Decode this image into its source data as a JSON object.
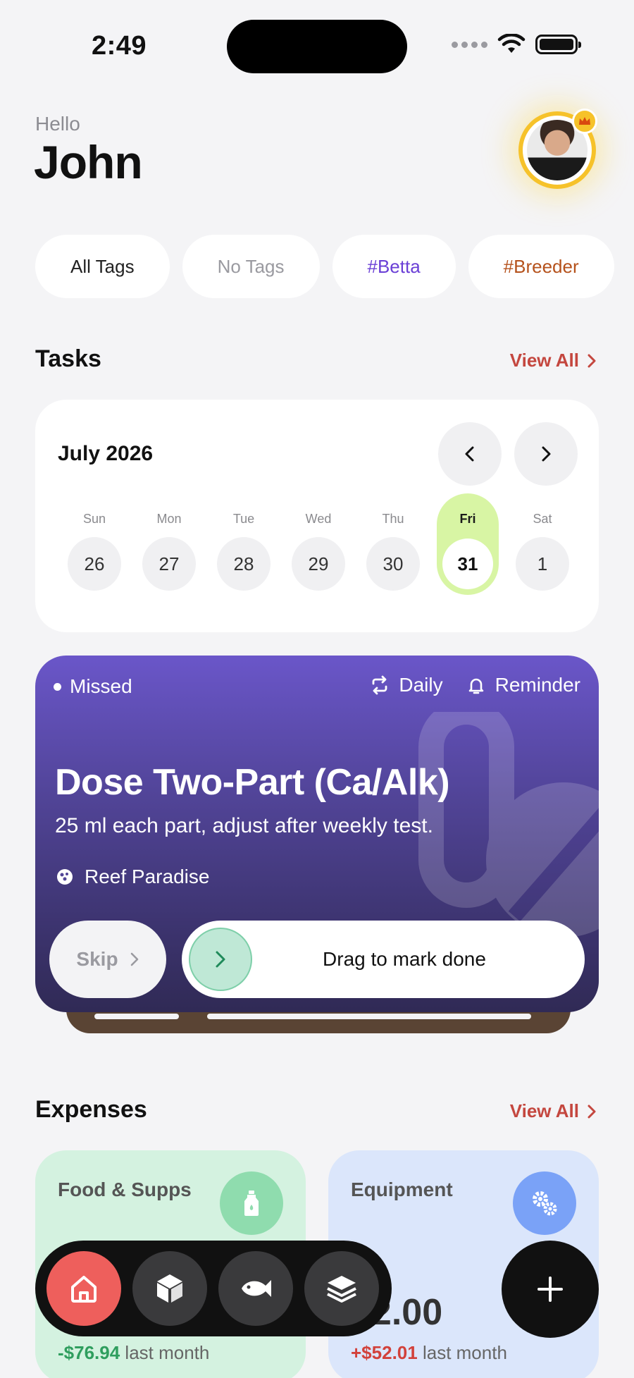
{
  "status_bar": {
    "time": "2:49"
  },
  "greeting": {
    "hello": "Hello",
    "name": "John"
  },
  "tags": [
    {
      "label": "All Tags"
    },
    {
      "label": "No Tags"
    },
    {
      "label": "#Betta"
    },
    {
      "label": "#Breeder"
    }
  ],
  "tasks": {
    "title": "Tasks",
    "view_all": "View All",
    "calendar": {
      "month": "July 2026",
      "days": [
        {
          "name": "Sun",
          "date": "26"
        },
        {
          "name": "Mon",
          "date": "27"
        },
        {
          "name": "Tue",
          "date": "28"
        },
        {
          "name": "Wed",
          "date": "29"
        },
        {
          "name": "Thu",
          "date": "30"
        },
        {
          "name": "Fri",
          "date": "31"
        },
        {
          "name": "Sat",
          "date": "1"
        }
      ],
      "selected_date": "31"
    },
    "card": {
      "status": "Missed",
      "frequency": "Daily",
      "reminder": "Reminder",
      "title": "Dose Two-Part (Ca/Alk)",
      "description": "25 ml each part, adjust after weekly test.",
      "tank": "Reef Paradise",
      "skip_label": "Skip",
      "drag_label": "Drag to mark done"
    }
  },
  "expenses": {
    "title": "Expenses",
    "view_all": "View All",
    "cards": [
      {
        "label": "Food & Supps",
        "change": "-$76.94",
        "suffix": "last month",
        "icon": "bottle-icon"
      },
      {
        "label": "Equipment",
        "amount": "72.00",
        "change": "+$52.01",
        "suffix": "last month",
        "icon": "gears-icon"
      }
    ]
  },
  "tabbar": {
    "tabs": [
      {
        "icon": "home-icon",
        "active": true
      },
      {
        "icon": "cube-icon",
        "active": false
      },
      {
        "icon": "fish-icon",
        "active": false
      },
      {
        "icon": "layers-icon",
        "active": false
      }
    ]
  },
  "colors": {
    "accent_red": "#c4473f",
    "task_purple": "#514497",
    "selected_day": "#d8f5a4",
    "tab_active": "#ee5f5c"
  }
}
